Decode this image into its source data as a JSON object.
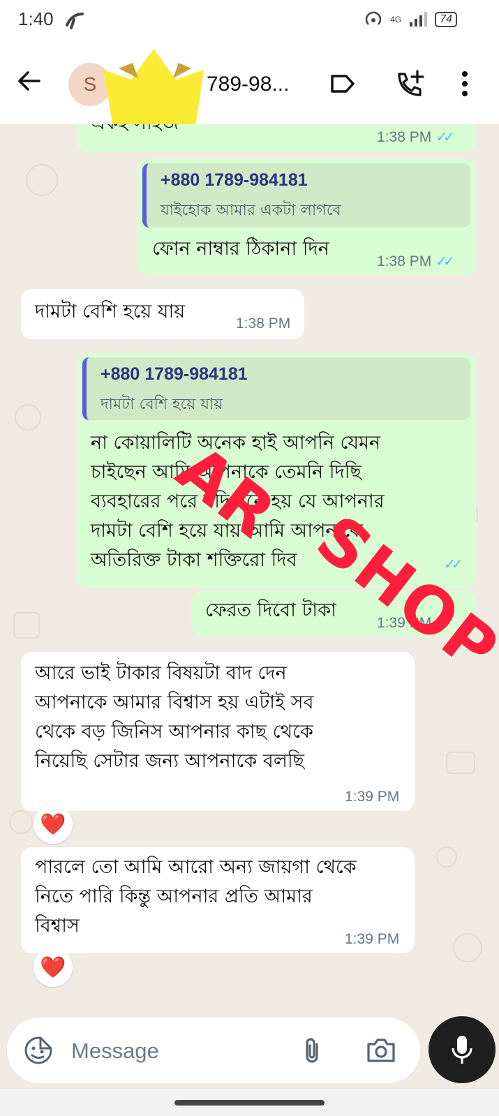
{
  "status_bar": {
    "time": "1:40",
    "battery": "74",
    "network": "4G"
  },
  "header": {
    "avatar_initial": "S",
    "contact_name": "789-98..."
  },
  "messages": {
    "m0": {
      "text": "একই সাইজ",
      "time": "1:38 PM"
    },
    "m1": {
      "quote_name": "+880 1789-984181",
      "quote_text": "যাইহোক আমার একটা লাগবে",
      "text": "ফোন নাম্বার ঠিকানা দিন",
      "time": "1:38 PM"
    },
    "m2": {
      "text": "দামটা বেশি হয়ে যায়",
      "time": "1:38 PM"
    },
    "m3": {
      "quote_name": "+880 1789-984181",
      "quote_text": "দামটা বেশি হয়ে যায়",
      "lines": [
        "না কোয়ালিটি অনেক হাই আপনি যেমন",
        "চাইছেন আমি আপনাকে তেমনি দিছি",
        "ব্যবহারের পরে যদি মনে হয় যে আপনার",
        "দামটা বেশি হয়ে যায় আমি আপনাকে",
        "অতিরিক্ত টাকা শক্তিরো দিব"
      ]
    },
    "m4": {
      "text": "ফেরত দিবো টাকা",
      "time": "1:39 PM"
    },
    "m5": {
      "lines": [
        "আরে ভাই টাকার বিষয়টা বাদ দেন",
        "আপনাকে আমার বিশ্বাস হয় এটাই সব",
        "থেকে বড় জিনিস আপনার কাছ থেকে",
        "নিয়েছি সেটার জন্য আপনাকে বলছি"
      ],
      "time": "1:39 PM",
      "reaction": "❤️"
    },
    "m6": {
      "lines": [
        "পারলে তো আমি আরো অন্য জায়গা থেকে",
        "নিতে পারি কিন্তু আপনার প্রতি আমার",
        "বিশ্বাস"
      ],
      "time": "1:39 PM",
      "reaction": "❤️"
    }
  },
  "watermark": {
    "part1": "AR",
    "part2": "SHOP",
    "color": "#ff1e3c"
  },
  "input": {
    "placeholder": "Message"
  },
  "colors": {
    "outgoing": "#d9fdd3",
    "incoming": "#ffffff",
    "ticks": "#53bdeb",
    "background": "#efeae2"
  }
}
